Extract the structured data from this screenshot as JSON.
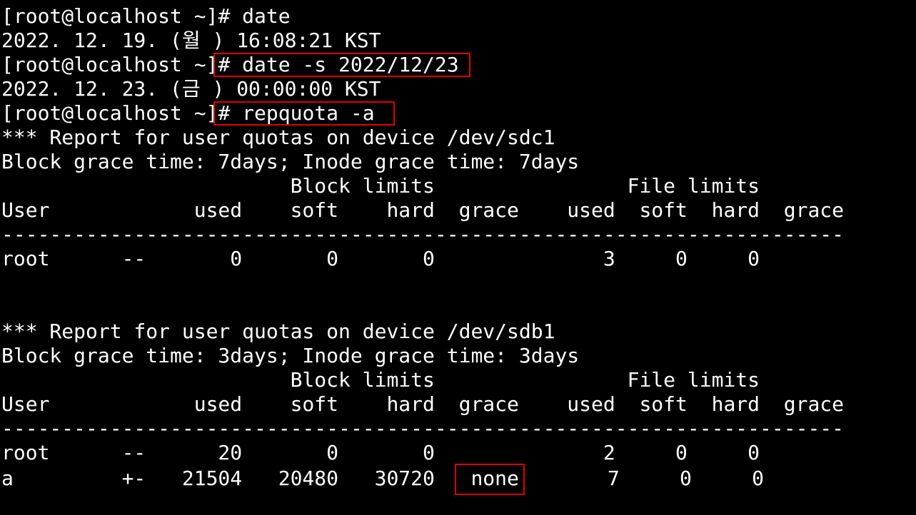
{
  "terminal": {
    "lines": [
      {
        "prompt": "[root@localhost ~]",
        "command": "# date"
      },
      {
        "text": "2022. 12. 19. (월 ) 16:08:21 KST"
      },
      {
        "prompt": "[root@localhost ~]",
        "command": "# date -s 2022/12/23"
      },
      {
        "text": "2022. 12. 23. (금 ) 00:00:00 KST"
      },
      {
        "prompt": "[root@localhost ~]",
        "command": "# repquota -a"
      },
      {
        "text": "*** Report for user quotas on device /dev/sdc1"
      },
      {
        "text": "Block grace time: 7days; Inode grace time: 7days"
      },
      {
        "text": "                        Block limits                File limits"
      },
      {
        "text": "User            used    soft    hard  grace    used  soft  hard  grace"
      },
      {
        "text": "----------------------------------------------------------------------"
      },
      {
        "text": "root      --       0       0       0              3     0     0"
      },
      {
        "text": ""
      },
      {
        "text": ""
      },
      {
        "text": "*** Report for user quotas on device /dev/sdb1"
      },
      {
        "text": "Block grace time: 3days; Inode grace time: 3days"
      },
      {
        "text": "                        Block limits                File limits"
      },
      {
        "text": "User            used    soft    hard  grace    used  soft  hard  grace"
      },
      {
        "text": "----------------------------------------------------------------------"
      },
      {
        "text": "root      --      20       0       0              2     0     0"
      },
      {
        "pre": "a         +-   21504   20480   30720   ",
        "grace": "none",
        "post": "       7     0     0"
      }
    ]
  },
  "colors": {
    "background": "#000000",
    "foreground": "#ffffff",
    "highlight_box": "#e00000"
  }
}
